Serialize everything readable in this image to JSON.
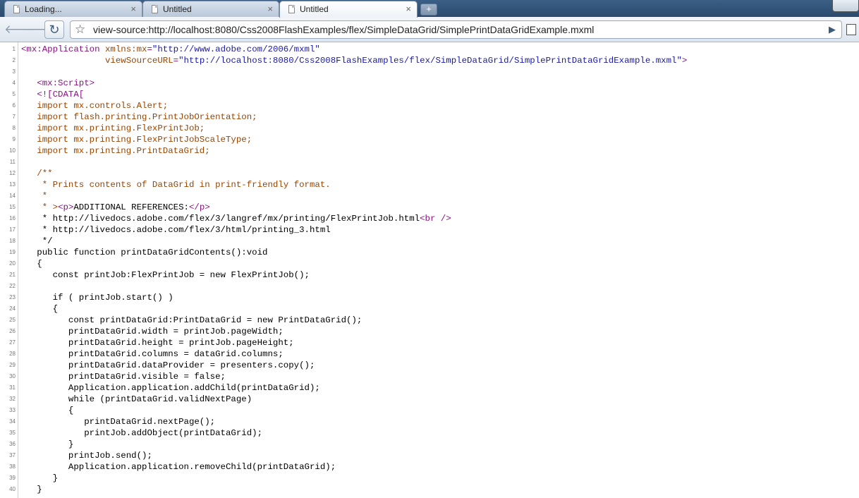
{
  "tabs": [
    {
      "title": "Loading...",
      "close": "×",
      "active": false
    },
    {
      "title": "Untitled",
      "close": "×",
      "active": false
    },
    {
      "title": "Untitled",
      "close": "×",
      "active": true
    }
  ],
  "new_tab_label": "+",
  "toolbar": {
    "back": "🡐",
    "forward": "🡒",
    "reload": "↻",
    "star": "☆",
    "url": "view-source:http://localhost:8080/Css2008FlashExamples/flex/SimpleDataGrid/SimplePrintDataGridExample.mxml",
    "go": "▶"
  },
  "source_lines": [
    {
      "n": "1",
      "t": "tag",
      "s": [
        {
          "c": "tag",
          "x": "<mx:Application "
        },
        {
          "c": "attr",
          "x": "xmlns:mx"
        },
        {
          "c": "tag",
          "x": "="
        },
        {
          "c": "val",
          "x": "\"http://www.adobe.com/2006/mxml\""
        }
      ]
    },
    {
      "n": "2",
      "s": [
        {
          "c": "",
          "x": "                "
        },
        {
          "c": "attr",
          "x": "viewSourceURL"
        },
        {
          "c": "tag",
          "x": "="
        },
        {
          "c": "val",
          "x": "\"http://localhost:8080/Css2008FlashExamples/flex/SimpleDataGrid/SimplePrintDataGridExample.mxml\""
        },
        {
          "c": "tag",
          "x": ">"
        }
      ]
    },
    {
      "n": "3",
      "s": []
    },
    {
      "n": "4",
      "s": [
        {
          "c": "",
          "x": "   "
        },
        {
          "c": "tag",
          "x": "<mx:Script>"
        }
      ]
    },
    {
      "n": "5",
      "s": [
        {
          "c": "",
          "x": "   "
        },
        {
          "c": "tag",
          "x": "<![CDATA["
        }
      ]
    },
    {
      "n": "6",
      "s": [
        {
          "c": "cdata",
          "x": "   import mx.controls.Alert;"
        }
      ]
    },
    {
      "n": "7",
      "s": [
        {
          "c": "cdata",
          "x": "   import flash.printing.PrintJobOrientation;"
        }
      ]
    },
    {
      "n": "8",
      "s": [
        {
          "c": "cdata",
          "x": "   import mx.printing.FlexPrintJob;"
        }
      ]
    },
    {
      "n": "9",
      "s": [
        {
          "c": "cdata",
          "x": "   import mx.printing.FlexPrintJobScaleType;"
        }
      ]
    },
    {
      "n": "10",
      "s": [
        {
          "c": "cdata",
          "x": "   import mx.printing.PrintDataGrid;"
        }
      ]
    },
    {
      "n": "11",
      "s": []
    },
    {
      "n": "12",
      "s": [
        {
          "c": "cdata",
          "x": "   /**"
        }
      ]
    },
    {
      "n": "13",
      "s": [
        {
          "c": "cdata",
          "x": "    * Prints contents of DataGrid in print-friendly format."
        }
      ]
    },
    {
      "n": "14",
      "s": [
        {
          "c": "cdata",
          "x": "    *"
        }
      ]
    },
    {
      "n": "15",
      "s": [
        {
          "c": "cdata",
          "x": "    * >"
        },
        {
          "c": "tag",
          "x": "<p>"
        },
        {
          "c": "",
          "x": "ADDITIONAL REFERENCES:"
        },
        {
          "c": "tag",
          "x": "</p>"
        }
      ]
    },
    {
      "n": "16",
      "s": [
        {
          "c": "",
          "x": "    * http://livedocs.adobe.com/flex/3/langref/mx/printing/FlexPrintJob.html"
        },
        {
          "c": "tag",
          "x": "<br />"
        }
      ]
    },
    {
      "n": "17",
      "s": [
        {
          "c": "",
          "x": "    * http://livedocs.adobe.com/flex/3/html/printing_3.html"
        }
      ]
    },
    {
      "n": "18",
      "s": [
        {
          "c": "",
          "x": "    */"
        }
      ]
    },
    {
      "n": "19",
      "s": [
        {
          "c": "",
          "x": "   public function printDataGridContents():void"
        }
      ]
    },
    {
      "n": "20",
      "s": [
        {
          "c": "",
          "x": "   {"
        }
      ]
    },
    {
      "n": "21",
      "s": [
        {
          "c": "",
          "x": "      const printJob:FlexPrintJob = new FlexPrintJob();"
        }
      ]
    },
    {
      "n": "22",
      "s": []
    },
    {
      "n": "23",
      "s": [
        {
          "c": "",
          "x": "      if ( printJob.start() )"
        }
      ]
    },
    {
      "n": "24",
      "s": [
        {
          "c": "",
          "x": "      {"
        }
      ]
    },
    {
      "n": "25",
      "s": [
        {
          "c": "",
          "x": "         const printDataGrid:PrintDataGrid = new PrintDataGrid();"
        }
      ]
    },
    {
      "n": "26",
      "s": [
        {
          "c": "",
          "x": "         printDataGrid.width = printJob.pageWidth;"
        }
      ]
    },
    {
      "n": "27",
      "s": [
        {
          "c": "",
          "x": "         printDataGrid.height = printJob.pageHeight;"
        }
      ]
    },
    {
      "n": "28",
      "s": [
        {
          "c": "",
          "x": "         printDataGrid.columns = dataGrid.columns;"
        }
      ]
    },
    {
      "n": "29",
      "s": [
        {
          "c": "",
          "x": "         printDataGrid.dataProvider = presenters.copy();"
        }
      ]
    },
    {
      "n": "30",
      "s": [
        {
          "c": "",
          "x": "         printDataGrid.visible = false;"
        }
      ]
    },
    {
      "n": "31",
      "s": [
        {
          "c": "",
          "x": "         Application.application.addChild(printDataGrid);"
        }
      ]
    },
    {
      "n": "32",
      "s": [
        {
          "c": "",
          "x": "         while (printDataGrid.validNextPage)"
        }
      ]
    },
    {
      "n": "33",
      "s": [
        {
          "c": "",
          "x": "         {"
        }
      ]
    },
    {
      "n": "34",
      "s": [
        {
          "c": "",
          "x": "            printDataGrid.nextPage();"
        }
      ]
    },
    {
      "n": "35",
      "s": [
        {
          "c": "",
          "x": "            printJob.addObject(printDataGrid);"
        }
      ]
    },
    {
      "n": "36",
      "s": [
        {
          "c": "",
          "x": "         }"
        }
      ]
    },
    {
      "n": "37",
      "s": [
        {
          "c": "",
          "x": "         printJob.send();"
        }
      ]
    },
    {
      "n": "38",
      "s": [
        {
          "c": "",
          "x": "         Application.application.removeChild(printDataGrid);"
        }
      ]
    },
    {
      "n": "39",
      "s": [
        {
          "c": "",
          "x": "      }"
        }
      ]
    },
    {
      "n": "40",
      "s": [
        {
          "c": "",
          "x": "   }"
        }
      ]
    }
  ]
}
